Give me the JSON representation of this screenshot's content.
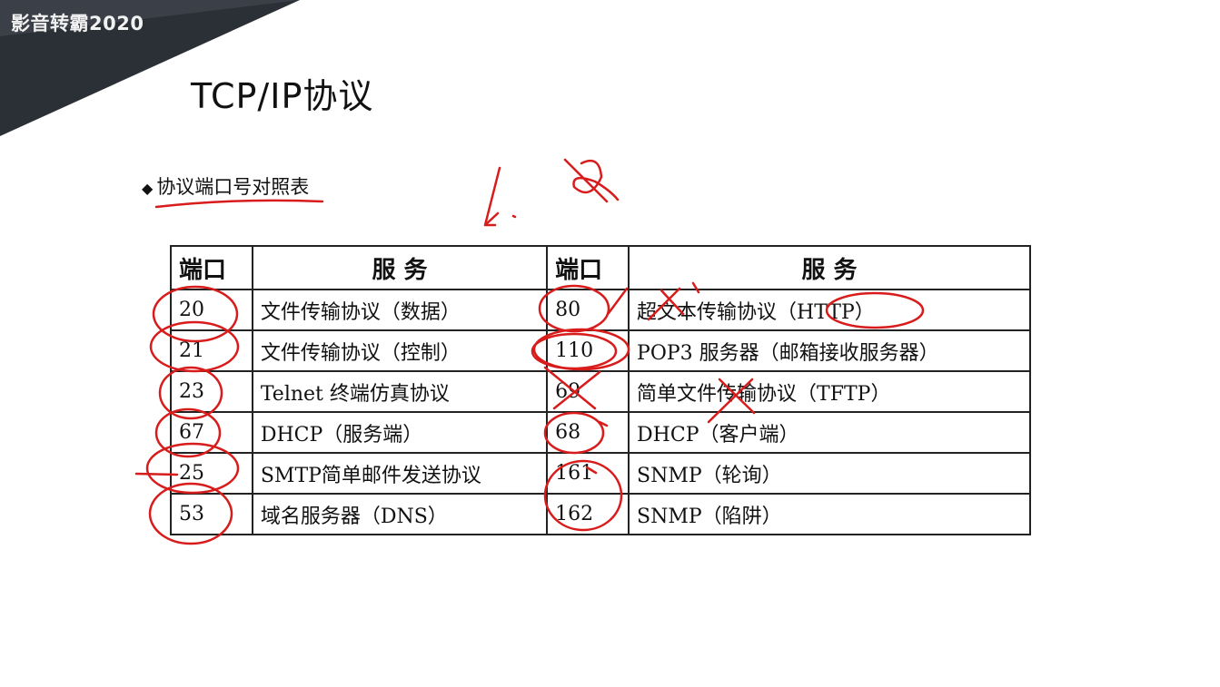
{
  "watermark": "影音转霸2020",
  "slide": {
    "title": "TCP/IP协议",
    "subtitle": "协议端口号对照表",
    "subtitle_bullet": "◆"
  },
  "table": {
    "headers": [
      "端口",
      "服 务",
      "端口",
      "服 务"
    ],
    "rows": [
      [
        "20",
        "文件传输协议（数据）",
        "80",
        "超文本传输协议（HTTP）"
      ],
      [
        "21",
        "文件传输协议（控制）",
        "110",
        "POP3 服务器（邮箱接收服务器）"
      ],
      [
        "23",
        "Telnet 终端仿真协议",
        "69",
        "简单文件传输协议（TFTP）"
      ],
      [
        "67",
        "DHCP（服务端）",
        "68",
        "DHCP（客户端）"
      ],
      [
        "25",
        "SMTP简单邮件发送协议",
        "161",
        "SNMP（轮询）"
      ],
      [
        "53",
        "域名服务器（DNS）",
        "162",
        "SNMP（陷阱）"
      ]
    ]
  },
  "colors": {
    "annotation": "#d81c1c",
    "corner": "#2b2f36"
  }
}
